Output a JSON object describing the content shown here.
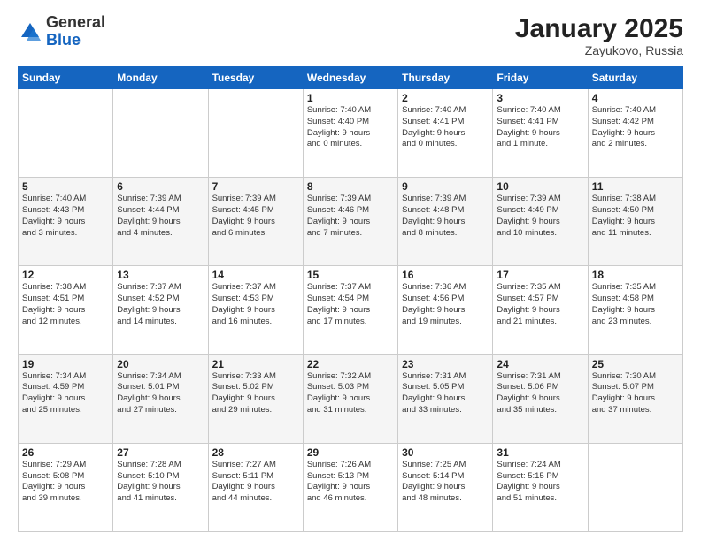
{
  "logo": {
    "general": "General",
    "blue": "Blue"
  },
  "header": {
    "month": "January 2025",
    "location": "Zayukovo, Russia"
  },
  "weekdays": [
    "Sunday",
    "Monday",
    "Tuesday",
    "Wednesday",
    "Thursday",
    "Friday",
    "Saturday"
  ],
  "weeks": [
    [
      {
        "day": "",
        "info": ""
      },
      {
        "day": "",
        "info": ""
      },
      {
        "day": "",
        "info": ""
      },
      {
        "day": "1",
        "info": "Sunrise: 7:40 AM\nSunset: 4:40 PM\nDaylight: 9 hours\nand 0 minutes."
      },
      {
        "day": "2",
        "info": "Sunrise: 7:40 AM\nSunset: 4:41 PM\nDaylight: 9 hours\nand 0 minutes."
      },
      {
        "day": "3",
        "info": "Sunrise: 7:40 AM\nSunset: 4:41 PM\nDaylight: 9 hours\nand 1 minute."
      },
      {
        "day": "4",
        "info": "Sunrise: 7:40 AM\nSunset: 4:42 PM\nDaylight: 9 hours\nand 2 minutes."
      }
    ],
    [
      {
        "day": "5",
        "info": "Sunrise: 7:40 AM\nSunset: 4:43 PM\nDaylight: 9 hours\nand 3 minutes."
      },
      {
        "day": "6",
        "info": "Sunrise: 7:39 AM\nSunset: 4:44 PM\nDaylight: 9 hours\nand 4 minutes."
      },
      {
        "day": "7",
        "info": "Sunrise: 7:39 AM\nSunset: 4:45 PM\nDaylight: 9 hours\nand 6 minutes."
      },
      {
        "day": "8",
        "info": "Sunrise: 7:39 AM\nSunset: 4:46 PM\nDaylight: 9 hours\nand 7 minutes."
      },
      {
        "day": "9",
        "info": "Sunrise: 7:39 AM\nSunset: 4:48 PM\nDaylight: 9 hours\nand 8 minutes."
      },
      {
        "day": "10",
        "info": "Sunrise: 7:39 AM\nSunset: 4:49 PM\nDaylight: 9 hours\nand 10 minutes."
      },
      {
        "day": "11",
        "info": "Sunrise: 7:38 AM\nSunset: 4:50 PM\nDaylight: 9 hours\nand 11 minutes."
      }
    ],
    [
      {
        "day": "12",
        "info": "Sunrise: 7:38 AM\nSunset: 4:51 PM\nDaylight: 9 hours\nand 12 minutes."
      },
      {
        "day": "13",
        "info": "Sunrise: 7:37 AM\nSunset: 4:52 PM\nDaylight: 9 hours\nand 14 minutes."
      },
      {
        "day": "14",
        "info": "Sunrise: 7:37 AM\nSunset: 4:53 PM\nDaylight: 9 hours\nand 16 minutes."
      },
      {
        "day": "15",
        "info": "Sunrise: 7:37 AM\nSunset: 4:54 PM\nDaylight: 9 hours\nand 17 minutes."
      },
      {
        "day": "16",
        "info": "Sunrise: 7:36 AM\nSunset: 4:56 PM\nDaylight: 9 hours\nand 19 minutes."
      },
      {
        "day": "17",
        "info": "Sunrise: 7:35 AM\nSunset: 4:57 PM\nDaylight: 9 hours\nand 21 minutes."
      },
      {
        "day": "18",
        "info": "Sunrise: 7:35 AM\nSunset: 4:58 PM\nDaylight: 9 hours\nand 23 minutes."
      }
    ],
    [
      {
        "day": "19",
        "info": "Sunrise: 7:34 AM\nSunset: 4:59 PM\nDaylight: 9 hours\nand 25 minutes."
      },
      {
        "day": "20",
        "info": "Sunrise: 7:34 AM\nSunset: 5:01 PM\nDaylight: 9 hours\nand 27 minutes."
      },
      {
        "day": "21",
        "info": "Sunrise: 7:33 AM\nSunset: 5:02 PM\nDaylight: 9 hours\nand 29 minutes."
      },
      {
        "day": "22",
        "info": "Sunrise: 7:32 AM\nSunset: 5:03 PM\nDaylight: 9 hours\nand 31 minutes."
      },
      {
        "day": "23",
        "info": "Sunrise: 7:31 AM\nSunset: 5:05 PM\nDaylight: 9 hours\nand 33 minutes."
      },
      {
        "day": "24",
        "info": "Sunrise: 7:31 AM\nSunset: 5:06 PM\nDaylight: 9 hours\nand 35 minutes."
      },
      {
        "day": "25",
        "info": "Sunrise: 7:30 AM\nSunset: 5:07 PM\nDaylight: 9 hours\nand 37 minutes."
      }
    ],
    [
      {
        "day": "26",
        "info": "Sunrise: 7:29 AM\nSunset: 5:08 PM\nDaylight: 9 hours\nand 39 minutes."
      },
      {
        "day": "27",
        "info": "Sunrise: 7:28 AM\nSunset: 5:10 PM\nDaylight: 9 hours\nand 41 minutes."
      },
      {
        "day": "28",
        "info": "Sunrise: 7:27 AM\nSunset: 5:11 PM\nDaylight: 9 hours\nand 44 minutes."
      },
      {
        "day": "29",
        "info": "Sunrise: 7:26 AM\nSunset: 5:13 PM\nDaylight: 9 hours\nand 46 minutes."
      },
      {
        "day": "30",
        "info": "Sunrise: 7:25 AM\nSunset: 5:14 PM\nDaylight: 9 hours\nand 48 minutes."
      },
      {
        "day": "31",
        "info": "Sunrise: 7:24 AM\nSunset: 5:15 PM\nDaylight: 9 hours\nand 51 minutes."
      },
      {
        "day": "",
        "info": ""
      }
    ]
  ]
}
